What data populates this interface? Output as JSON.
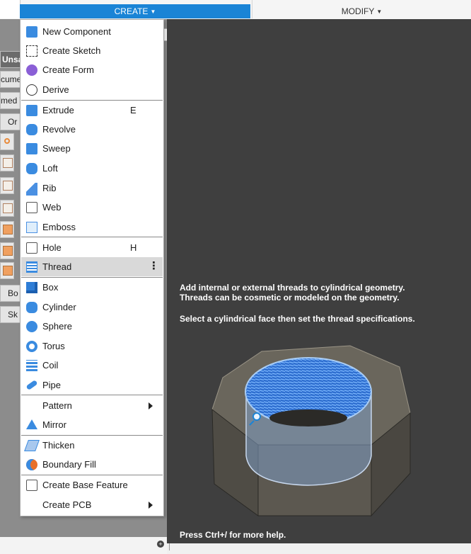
{
  "toolbar": {
    "create_label": "CREATE",
    "modify_label": "MODIFY"
  },
  "browser": {
    "peeks": [
      "Unsa",
      "cume",
      "med V",
      "Or",
      "Bo",
      "Sk"
    ]
  },
  "menu": {
    "items": [
      {
        "label": "New Component",
        "icon": "new-component-icon"
      },
      {
        "label": "Create Sketch",
        "icon": "create-sketch-icon"
      },
      {
        "label": "Create Form",
        "icon": "create-form-icon"
      },
      {
        "label": "Derive",
        "icon": "derive-icon"
      },
      {
        "label": "Extrude",
        "icon": "extrude-icon",
        "shortcut": "E"
      },
      {
        "label": "Revolve",
        "icon": "revolve-icon"
      },
      {
        "label": "Sweep",
        "icon": "sweep-icon"
      },
      {
        "label": "Loft",
        "icon": "loft-icon"
      },
      {
        "label": "Rib",
        "icon": "rib-icon"
      },
      {
        "label": "Web",
        "icon": "web-icon"
      },
      {
        "label": "Emboss",
        "icon": "emboss-icon"
      },
      {
        "label": "Hole",
        "icon": "hole-icon",
        "shortcut": "H"
      },
      {
        "label": "Thread",
        "icon": "thread-icon",
        "highlighted": true
      },
      {
        "label": "Box",
        "icon": "box-icon"
      },
      {
        "label": "Cylinder",
        "icon": "cylinder-icon"
      },
      {
        "label": "Sphere",
        "icon": "sphere-icon"
      },
      {
        "label": "Torus",
        "icon": "torus-icon"
      },
      {
        "label": "Coil",
        "icon": "coil-icon"
      },
      {
        "label": "Pipe",
        "icon": "pipe-icon"
      },
      {
        "label": "Pattern",
        "submenu": true
      },
      {
        "label": "Mirror",
        "icon": "mirror-icon"
      },
      {
        "label": "Thicken",
        "icon": "thicken-icon"
      },
      {
        "label": "Boundary Fill",
        "icon": "boundary-fill-icon"
      },
      {
        "label": "Create Base Feature",
        "icon": "create-base-feature-icon"
      },
      {
        "label": "Create PCB",
        "submenu": true
      }
    ],
    "more_glyph": "⋮"
  },
  "tooltip": {
    "line1": "Add internal or external threads to cylindrical geometry.",
    "line2": "Threads can be cosmetic or modeled on the geometry.",
    "line3": "Select a cylindrical face then set the thread specifications.",
    "help": "Press Ctrl+/ for more help."
  },
  "colors": {
    "accent": "#1a84d6",
    "canvas": "#3f3f3f",
    "thread_blue": "#3a8be0"
  }
}
